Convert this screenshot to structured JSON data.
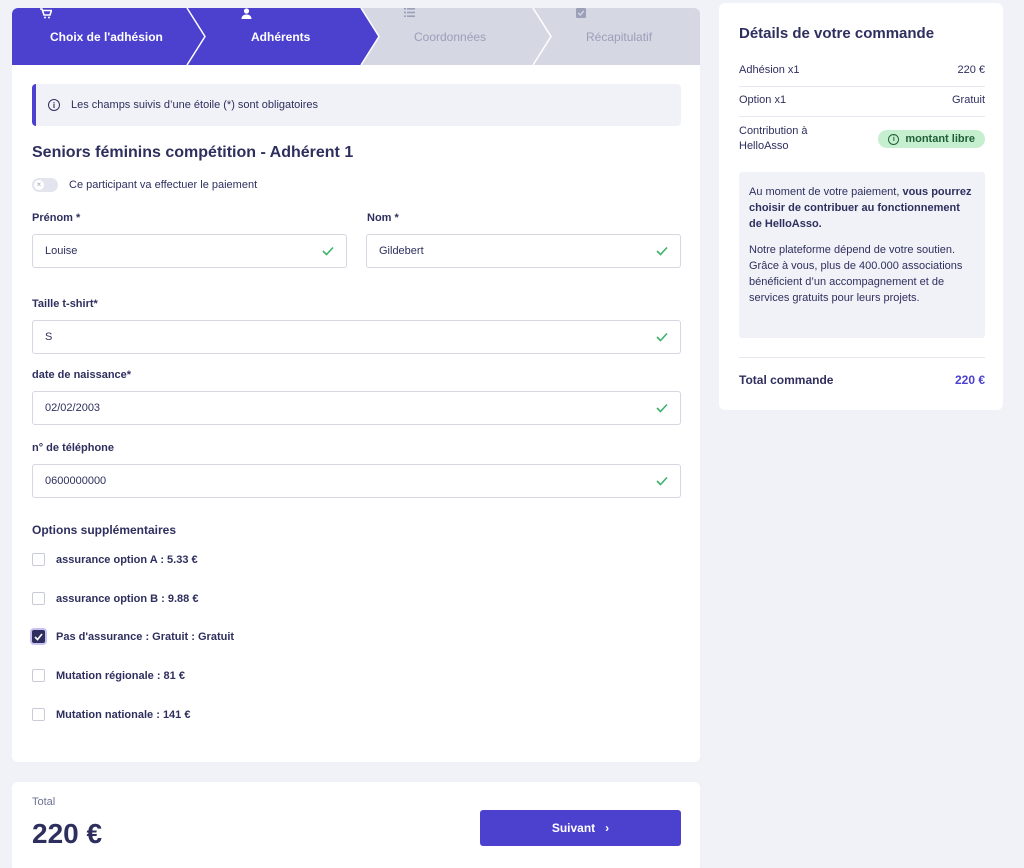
{
  "stepper": {
    "steps": [
      {
        "label": "Choix de l'adhésion",
        "icon": "cart-icon",
        "state": "done"
      },
      {
        "label": "Adhérents",
        "icon": "user-icon",
        "state": "current"
      },
      {
        "label": "Coordonnées",
        "icon": "list-icon",
        "state": "upcoming"
      },
      {
        "label": "Récapitulatif",
        "icon": "checkbox-icon",
        "state": "upcoming"
      }
    ],
    "active_color": "#4c40cf",
    "inactive_color": "#d5d7e3"
  },
  "info": {
    "text": "Les champs suivis d’une étoile (*) sont obligatoires"
  },
  "form": {
    "section_title": "Seniors féminins compétition - Adhérent 1",
    "payer_toggle_label": "Ce participant va effectuer le paiement",
    "prenom": {
      "label": "Prénom *",
      "value": "Louise"
    },
    "nom": {
      "label": "Nom *",
      "value": "Gildebert"
    },
    "taille": {
      "label": "Taille t-shirt*",
      "value": "S"
    },
    "naissance": {
      "label": "date de naissance*",
      "value": "02/02/2003"
    },
    "telephone": {
      "label": "n° de téléphone",
      "value": "0600000000"
    },
    "options_title": "Options supplémentaires",
    "options": [
      {
        "label": "assurance option A : 5.33 €",
        "checked": false
      },
      {
        "label": "assurance option B : 9.88 €",
        "checked": false
      },
      {
        "label": "Pas d'assurance : Gratuit : Gratuit",
        "checked": true
      },
      {
        "label": "Mutation régionale : 81 €",
        "checked": false
      },
      {
        "label": "Mutation nationale : 141 €",
        "checked": false
      }
    ]
  },
  "footer": {
    "total_label": "Total",
    "total_value": "220 €",
    "next_label": "Suivant"
  },
  "order": {
    "title": "Détails de votre commande",
    "rows": [
      {
        "label": "Adhésion x1",
        "value": "220 €"
      },
      {
        "label": "Option x1",
        "value": "Gratuit"
      }
    ],
    "contribution_label": "Contribution à HelloAsso",
    "contribution_pill": "montant libre",
    "box_p1_prefix": "Au moment de votre paiement, ",
    "box_p1_bold": "vous pourrez choisir de contribuer au fonctionnement de HelloAsso.",
    "box_p2": "Notre plateforme dépend de votre soutien. Grâce à vous, plus de 400.000 associations bénéficient d’un accompagnement et de services gratuits pour leurs projets.",
    "total_label": "Total commande",
    "total_value": "220 €"
  },
  "colors": {
    "accent": "#4c40cf",
    "success": "#3bb36b",
    "pill_bg": "#c6efcf"
  }
}
